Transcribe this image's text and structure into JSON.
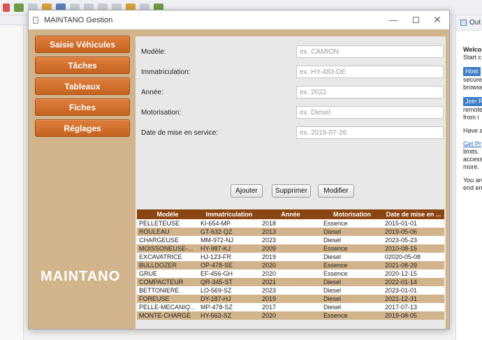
{
  "window": {
    "title": "MAINTANO Gestion"
  },
  "sidebar": {
    "items": [
      {
        "label": "Saisie Véhicules"
      },
      {
        "label": "Tâches"
      },
      {
        "label": "Tableaux"
      },
      {
        "label": "Fiches"
      },
      {
        "label": "Réglages"
      }
    ],
    "logo": "MAINTANO"
  },
  "form": {
    "fields": [
      {
        "label": "Modèle:",
        "placeholder": "ex. CAMION"
      },
      {
        "label": "Immatriculation:",
        "placeholder": "ex. HY-483-DE"
      },
      {
        "label": "Année:",
        "placeholder": "ex. 2022"
      },
      {
        "label": "Motorisation:",
        "placeholder": "ex. Diesel"
      },
      {
        "label": "Date de mise en service:",
        "placeholder": "ex. 2019-07-26"
      }
    ]
  },
  "actions": {
    "add": "Ajouter",
    "delete": "Supprimer",
    "edit": "Modifier"
  },
  "table": {
    "columns": [
      "Modèle",
      "Immatriculation",
      "Année",
      "Motorisation",
      "Date de mise en ..."
    ],
    "rows": [
      [
        "PELLETEUSE",
        "KI-654-MP",
        "2018",
        "Essence",
        "2015-01-01"
      ],
      [
        "ROULEAU",
        "GT-632-QZ",
        "2013",
        "Diesel",
        "2019-05-06"
      ],
      [
        "CHARGEUSE",
        "MM-972-NJ",
        "2023",
        "Diesel",
        "2023-05-23"
      ],
      [
        "MOISSONEUSE-...",
        "HY-987-KJ",
        "2009",
        "Essence",
        "2010-08-15"
      ],
      [
        "EXCAVATRICE",
        "HJ-123-FR",
        "2019",
        "Diesel",
        "02020-05-08"
      ],
      [
        "BULLDOZER",
        "OP-478-SE",
        "2020",
        "Essence",
        "2021-08-29"
      ],
      [
        "GRUE",
        "EF-456-GH",
        "2020",
        "Essence",
        "2020-12-15"
      ],
      [
        "COMPACTEUR",
        "QR-345-ST",
        "2021",
        "Diesel",
        "2022-01-14"
      ],
      [
        "BETTONIERE",
        "LO-569-SZ",
        "2023",
        "Diesel",
        "2023-01-01"
      ],
      [
        "FOREUSE",
        "DY-187-HJ",
        "2019",
        "Diesel",
        "2021-12-31"
      ],
      [
        "PELLE-MECANIQ...",
        "MP-478-SZ",
        "2017",
        "Diesel",
        "2017-07-13"
      ],
      [
        "MONTE-CHARGE",
        "HY-563-SZ",
        "2020",
        "Essence",
        "2019-08-05"
      ]
    ]
  },
  "ide": {
    "outline_tab": "Out",
    "welcome": {
      "title": "Welco",
      "line1": "Start c",
      "btn1": "Host",
      "t1": "secure",
      "t2": "browse",
      "btn2": "Join R",
      "t3": "remote",
      "t4": "from i",
      "t5": "Have a",
      "link": "Get Pr",
      "t6": "limits.",
      "t7": "access",
      "t8": "more.",
      "t9": "You are",
      "t10": "end en"
    }
  }
}
